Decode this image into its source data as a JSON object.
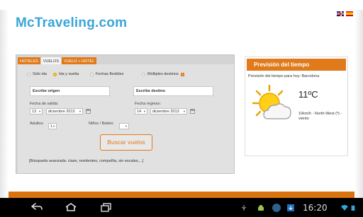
{
  "site": {
    "logo": "McTraveling.com"
  },
  "languages": [
    "en-flag",
    "es-flag"
  ],
  "tabs": [
    {
      "label": "HOTELES",
      "active": false
    },
    {
      "label": "VUELOS",
      "active": true
    },
    {
      "label": "VUELO + HOTEL",
      "active": false
    }
  ],
  "trip_type": [
    {
      "label": "Sólo ida",
      "checked": false
    },
    {
      "label": "Ida y vuelta",
      "checked": true
    },
    {
      "label": "Fechas flexibles",
      "checked": false
    },
    {
      "label": "Múltiples destinos",
      "checked": false
    }
  ],
  "origin": {
    "value": "Escribe origen"
  },
  "destination": {
    "value": "Escribe destino"
  },
  "departure": {
    "label": "Fecha de salida:",
    "day": "13",
    "month": "diciembre 2013"
  },
  "return": {
    "label": "Fecha regreso:",
    "day": "14",
    "month": "diciembre 2013"
  },
  "adults": {
    "label": "Adultos:",
    "value": "1"
  },
  "children": {
    "label": "Niños / Bebés:",
    "value": ""
  },
  "search_button": "Buscar vuelos",
  "advanced_search": "[Búsqueda avanzada: clase, residentes, compañía, sin escalas,...]",
  "weather": {
    "title": "Previsión del tiempo",
    "subtitle": "Previsión del tiempo para hoy: Barcelona",
    "temperature": "11ºC",
    "wind": "10km/h - North-West (º) - viento",
    "icon": "partly-cloudy-icon"
  },
  "status_bar": {
    "time": "16:20"
  },
  "colors": {
    "accent": "#e07a1b",
    "logo": "#3aa6d8",
    "panel": "#d4d4d4"
  }
}
